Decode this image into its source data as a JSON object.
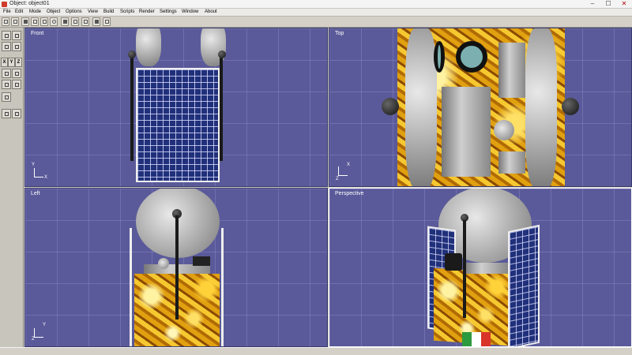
{
  "window": {
    "title": "Object: object01",
    "min_glyph": "–",
    "max_glyph": "☐",
    "close_glyph": "✕"
  },
  "menu": [
    "File",
    "Edit",
    "Mode",
    "Object",
    "Options",
    "View",
    "Build",
    "Scripts",
    "Render",
    "Settings",
    "Window",
    "About"
  ],
  "sidebar": {
    "axis_buttons": [
      "X",
      "Y",
      "Z"
    ]
  },
  "viewports": {
    "front": {
      "label": "Front",
      "axis_up": "Y",
      "axis_right": "X"
    },
    "top": {
      "label": "Top",
      "axis_up": "X",
      "axis_right": "Z"
    },
    "left": {
      "label": "Left",
      "axis_up": "Y",
      "axis_right": "Z"
    },
    "perspective": {
      "label": "Perspective"
    }
  },
  "colors": {
    "viewport_bg": "#5a5a9a",
    "gold_foil": "#e0a010",
    "solar_panel": "#20307a"
  }
}
